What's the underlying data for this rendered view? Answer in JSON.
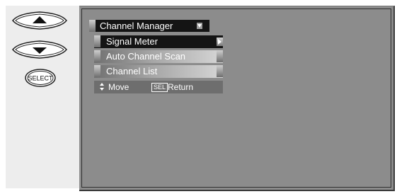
{
  "remote": {
    "up_icon": "up-arrow-icon",
    "down_icon": "down-arrow-icon",
    "select_label": "SELECT"
  },
  "menu": {
    "title": "Channel Manager",
    "items": [
      {
        "label": "Signal Meter",
        "selected": true
      },
      {
        "label": "Auto Channel Scan",
        "selected": false
      },
      {
        "label": "Channel List",
        "selected": false
      }
    ],
    "help": {
      "move_label": "Move",
      "sel_label": "SEL",
      "return_label": "Return"
    }
  },
  "colors": {
    "screen_bg": "#8c8c8c",
    "selected_bg": "#141414",
    "panel_bg": "#ededed"
  }
}
